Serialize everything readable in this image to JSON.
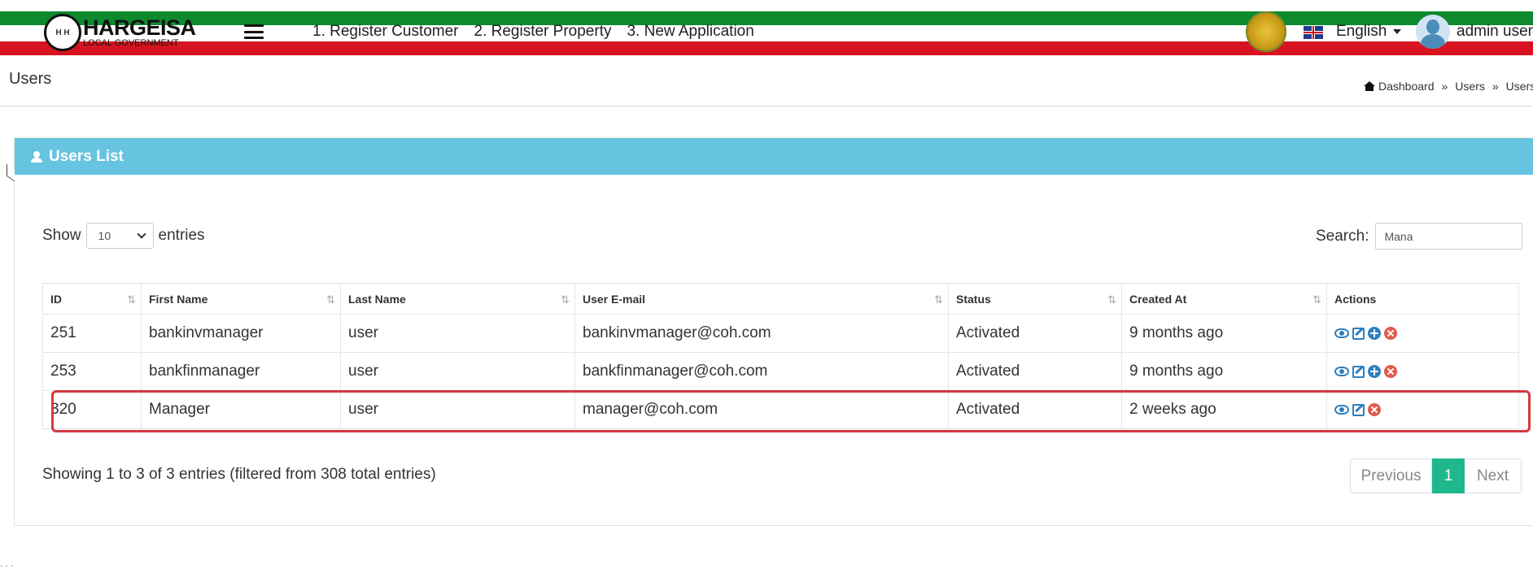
{
  "header": {
    "logo_text": "HARGEISA",
    "logo_subtext": "LOCAL GOVERNMENT",
    "logo_badge": "H H",
    "nav": [
      {
        "label": "1. Register Customer"
      },
      {
        "label": "2. Register Property"
      },
      {
        "label": "3. New Application"
      }
    ],
    "language": "English",
    "username": "admin user"
  },
  "page": {
    "title": "Users",
    "breadcrumb": [
      "Dashboard",
      "Users",
      "Users l"
    ],
    "breadcrumb_separator": "»"
  },
  "box": {
    "title": "Users List"
  },
  "controls": {
    "show_label": "Show",
    "entries_value": "10",
    "entries_label": "entries",
    "search_label": "Search:",
    "search_value": "Mana"
  },
  "table": {
    "columns": [
      "ID",
      "First Name",
      "Last Name",
      "User E-mail",
      "Status",
      "Created At",
      "Actions"
    ],
    "rows": [
      {
        "id": "251",
        "first": "bankinvmanager",
        "last": "user",
        "email": "bankinvmanager@coh.com",
        "status": "Activated",
        "created": "9 months ago"
      },
      {
        "id": "253",
        "first": "bankfinmanager",
        "last": "user",
        "email": "bankfinmanager@coh.com",
        "status": "Activated",
        "created": "9 months ago"
      },
      {
        "id": "320",
        "first": "Manager",
        "last": "user",
        "email": "manager@coh.com",
        "status": "Activated",
        "created": "2 weeks ago"
      }
    ]
  },
  "footer": {
    "info": "Showing 1 to 3 of 3 entries (filtered from 308 total entries)",
    "prev": "Previous",
    "page": "1",
    "next": "Next"
  },
  "colors": {
    "header_green": "#0e8a2e",
    "header_red": "#d7131f",
    "box_header": "#67c4e0",
    "pagination_active": "#1fb88c",
    "highlight": "#d6383f",
    "action_blue": "#2d7fc1",
    "action_red": "#e05a4e"
  }
}
